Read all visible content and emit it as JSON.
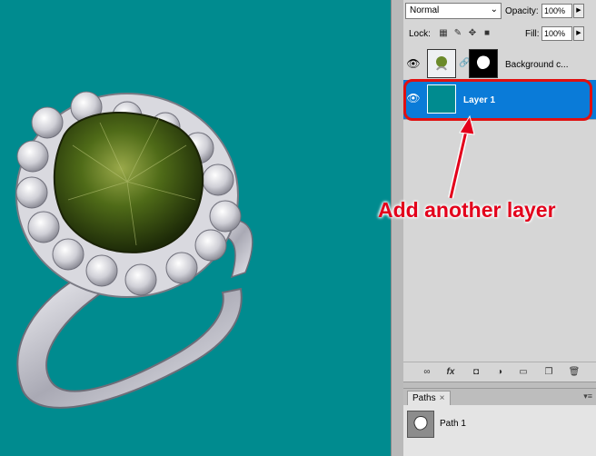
{
  "canvas": {
    "background_color": "#008b8f",
    "image_subject": "silver ring with green gemstone and diamonds"
  },
  "layers_panel": {
    "blend_mode": "Normal",
    "opacity_label": "Opacity:",
    "opacity_value": "100%",
    "lock_label": "Lock:",
    "fill_label": "Fill:",
    "fill_value": "100%",
    "layers": [
      {
        "name": "Background c...",
        "visible": true,
        "selected": false
      },
      {
        "name": "Layer 1",
        "visible": true,
        "selected": true,
        "thumb_color": "#008b8f"
      }
    ],
    "selected_color": "#0a7bd8",
    "tool_icons": [
      "link-icon",
      "fx-icon",
      "mask-icon",
      "adjustment-icon",
      "group-icon",
      "new-layer-icon",
      "trash-icon"
    ]
  },
  "paths_panel": {
    "tab_label": "Paths",
    "paths": [
      {
        "name": "Path 1"
      }
    ]
  },
  "annotation": {
    "text": "Add another layer",
    "color": "#e3001b"
  }
}
